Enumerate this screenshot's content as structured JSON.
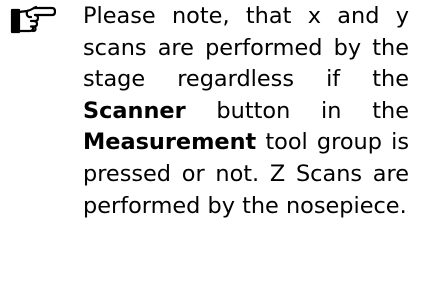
{
  "note": {
    "icon": "pointing-hand-icon",
    "text_part1": "Please note, that x and y scans are performed by the stage regardless if the ",
    "scanner_label": "Scanner",
    "text_part2": " button in the ",
    "measurement_label": "Measurement",
    "text_part3": " tool group is pressed or not. Z Scans are performed by the nosepiece."
  }
}
